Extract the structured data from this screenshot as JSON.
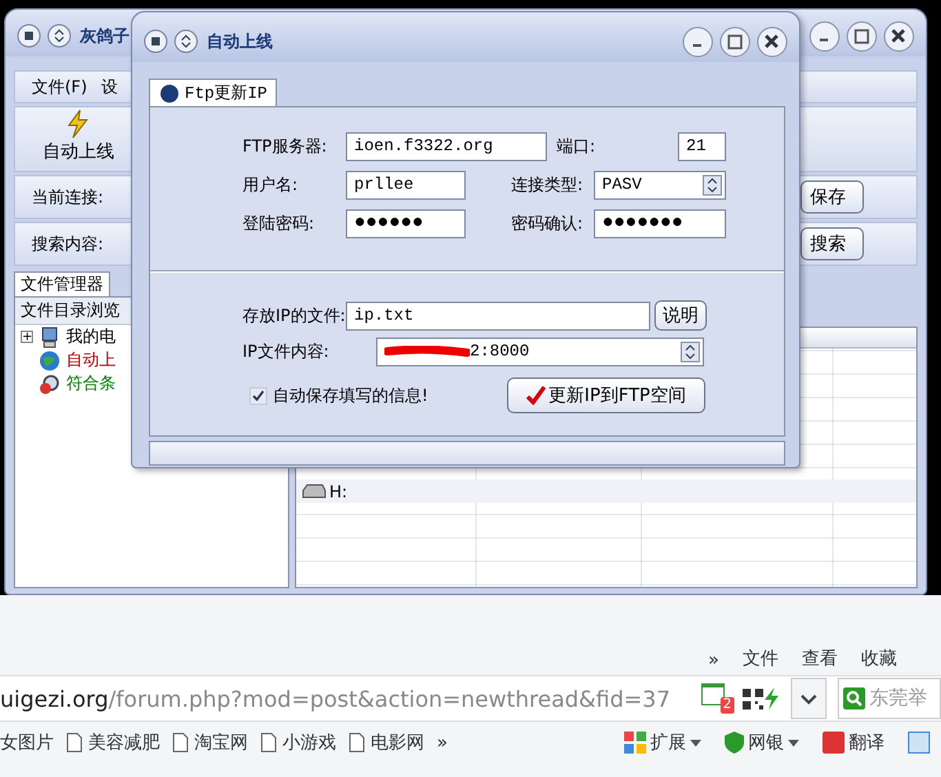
{
  "main_window": {
    "title": "灰鸽子",
    "menu": [
      "文件(F)",
      "设"
    ],
    "toolbar_button": "自动上线",
    "connection_label": "当前连接:",
    "search_label": "搜索内容:",
    "save_button": "保存",
    "search_button": "搜索",
    "tabs": [
      {
        "label": "文件管理器",
        "selected": true
      }
    ],
    "tree_header": "文件目录浏览",
    "tree": [
      {
        "label": "我的电",
        "kind": "computer",
        "expander": "+",
        "color": "#000000"
      },
      {
        "label": "自动上",
        "kind": "globe",
        "color": "#c00000"
      },
      {
        "label": "符合条",
        "kind": "search",
        "color": "#008000"
      }
    ],
    "file_list": {
      "rows": [
        {
          "name": "H:",
          "kind": "drive"
        }
      ]
    }
  },
  "dialog": {
    "title": "自动上线",
    "tab": "Ftp更新IP",
    "server_label": "FTP服务器:",
    "server": "ioen.f3322.org",
    "port_label": "端口:",
    "port": "21",
    "user_label": "用户名:",
    "user": "prllee",
    "type_label": "连接类型:",
    "type": "PASV",
    "password_label": "登陆密码:",
    "password": "●●●●●●",
    "confirm_label": "密码确认:",
    "confirm": "●●●●●●●",
    "file_label": "存放IP的文件:",
    "file": "ip.txt",
    "help_button": "说明",
    "content_label": "IP文件内容:",
    "content": "2:8000",
    "content_redacted": true,
    "autosave": {
      "label": "自动保存填写的信息!",
      "checked": true
    },
    "update_button": "更新IP到FTP空间"
  },
  "browser": {
    "menu": [
      "»",
      "文件",
      "查看",
      "收藏"
    ],
    "url_host": "uigezi.org",
    "url_path": "/forum.php?mod=post&action=newthread&fid=37",
    "badge": "2",
    "search_placeholder": "东莞举",
    "bookmarks": [
      "女图片",
      "美容减肥",
      "淘宝网",
      "小游戏",
      "电影网"
    ],
    "more": "»",
    "tools": [
      "扩展",
      "网银",
      "翻译"
    ]
  }
}
